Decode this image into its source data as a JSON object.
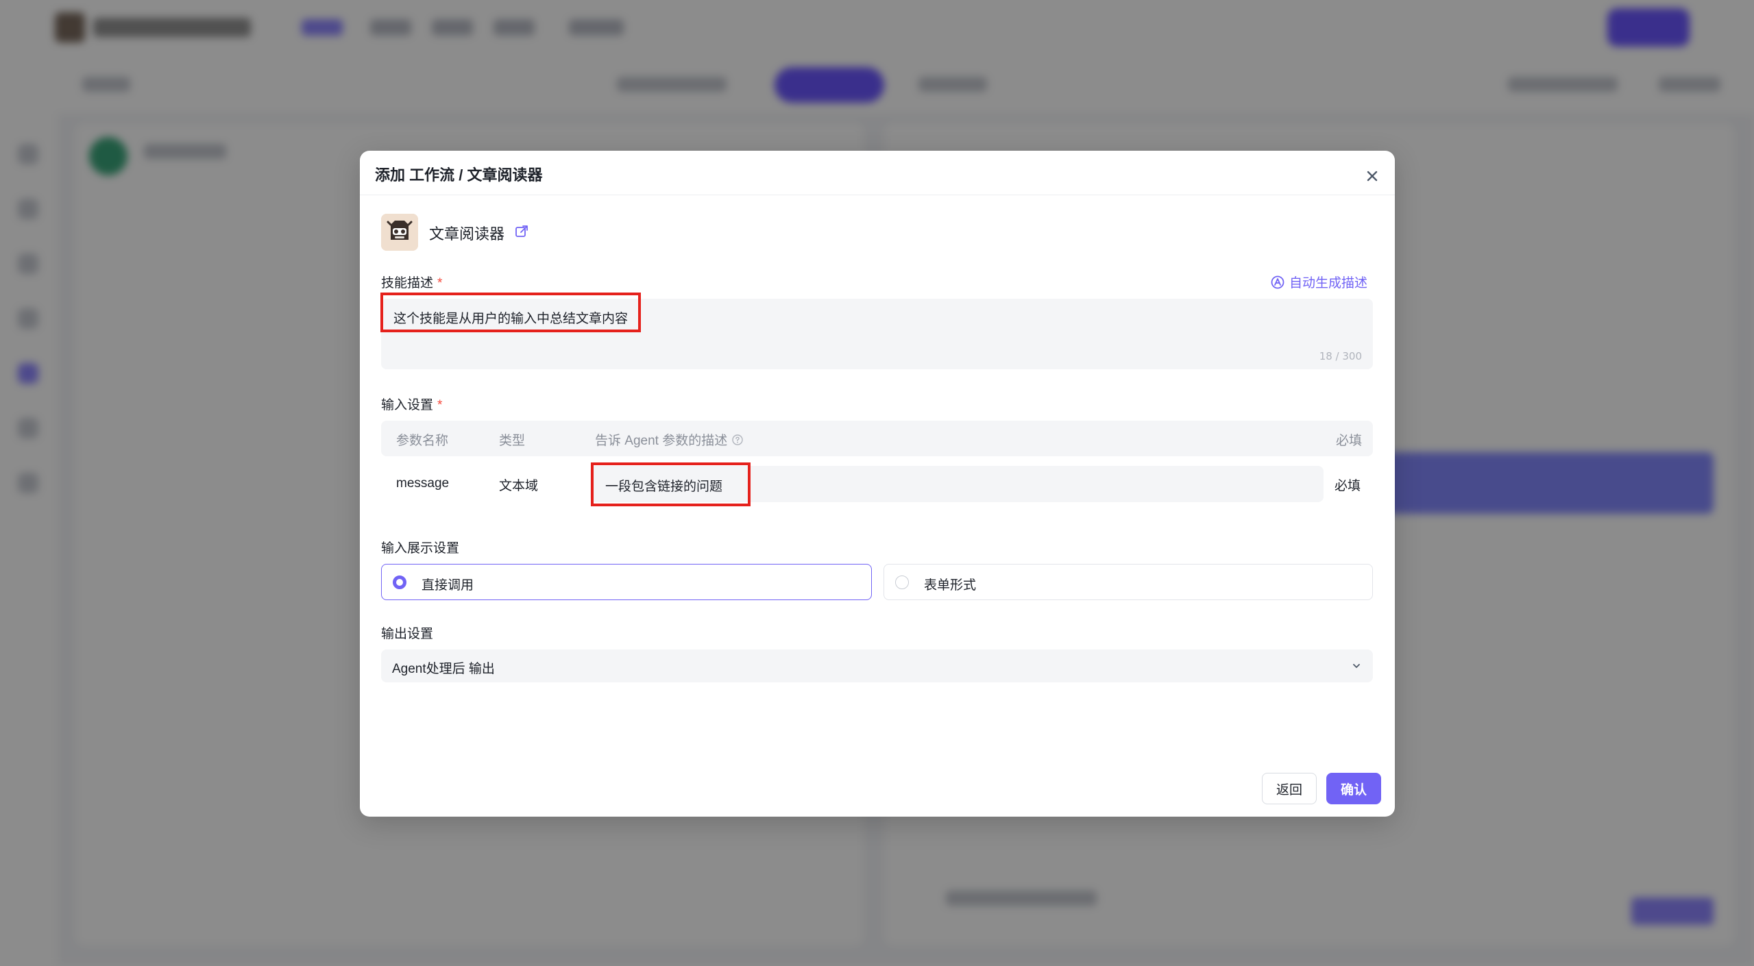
{
  "modal": {
    "title": "添加 工作流 / 文章阅读器",
    "workflow_name": "文章阅读器",
    "icons": {
      "close": "close-icon",
      "external_link": "external-link-icon",
      "auto_generate": "ai-generate-icon",
      "help": "help-circle-icon",
      "chevron": "chevron-down-icon"
    },
    "skill_description": {
      "label": "技能描述",
      "required_mark": "*",
      "auto_generate_label": "自动生成描述",
      "value": "这个技能是从用户的输入中总结文章内容",
      "counter": "18 / 300"
    },
    "input_settings": {
      "label": "输入设置",
      "required_mark": "*",
      "columns": [
        "参数名称",
        "类型",
        "告诉 Agent 参数的描述",
        "必填"
      ],
      "rows": [
        {
          "name": "message",
          "type": "文本域",
          "description": "一段包含链接的问题",
          "required": "必填"
        }
      ]
    },
    "input_display": {
      "label": "输入展示设置",
      "options": [
        {
          "label": "直接调用",
          "selected": true
        },
        {
          "label": "表单形式",
          "selected": false
        }
      ]
    },
    "output_settings": {
      "label": "输出设置",
      "selected": "Agent处理后 输出"
    },
    "buttons": {
      "back": "返回",
      "confirm": "确认"
    },
    "colors": {
      "accent": "#7163f5",
      "highlight": "#e5211c",
      "required": "#f5483b"
    }
  }
}
